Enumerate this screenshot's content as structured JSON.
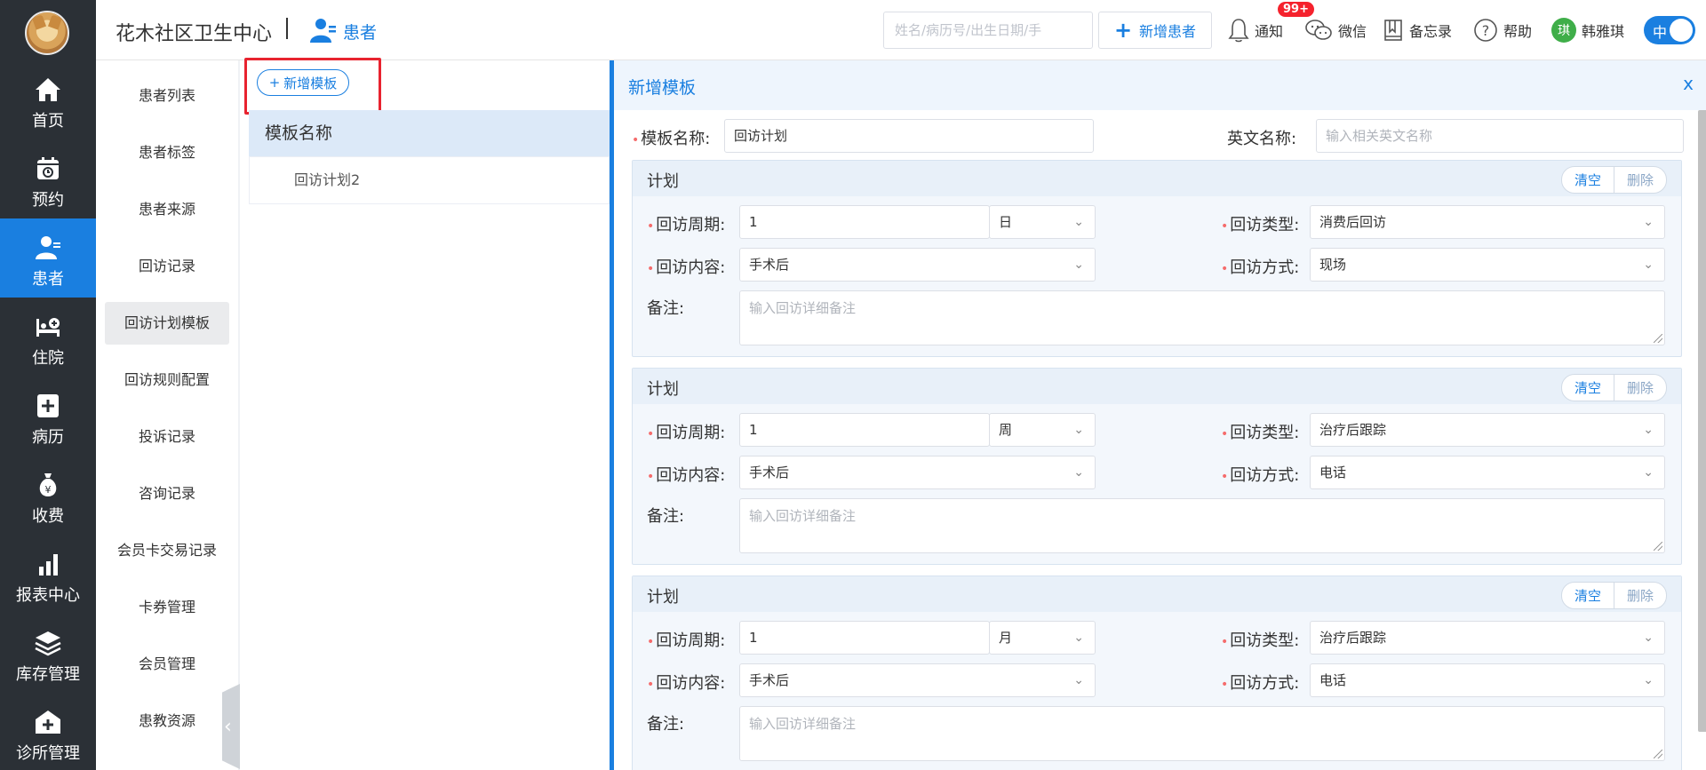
{
  "app": {
    "org_name": "花木社区卫生中心",
    "module": "患者"
  },
  "leftnav": [
    {
      "label": "首页",
      "icon": "home-icon"
    },
    {
      "label": "预约",
      "icon": "calendar-icon"
    },
    {
      "label": "患者",
      "icon": "patient-icon"
    },
    {
      "label": "住院",
      "icon": "bed-icon"
    },
    {
      "label": "病历",
      "icon": "medical-record-icon"
    },
    {
      "label": "收费",
      "icon": "money-bag-icon"
    },
    {
      "label": "报表中心",
      "icon": "bar-chart-icon"
    },
    {
      "label": "库存管理",
      "icon": "layers-icon"
    },
    {
      "label": "诊所管理",
      "icon": "clinic-icon"
    }
  ],
  "header": {
    "search_placeholder": "姓名/病历号/出生日期/手",
    "new_patient": "新增患者",
    "notify": "通知",
    "notify_badge": "99+",
    "wechat": "微信",
    "memo": "备忘录",
    "help": "帮助",
    "user_initial": "琪",
    "user_name": "韩雅琪",
    "lang": "中"
  },
  "submenu": [
    "患者列表",
    "患者标签",
    "患者来源",
    "回访记录",
    "回访计划模板",
    "回访规则配置",
    "投诉记录",
    "咨询记录",
    "会员卡交易记录",
    "卡券管理",
    "会员管理",
    "患教资源"
  ],
  "template_list": {
    "add_button": "新增模板",
    "column_header": "模板名称",
    "rows": [
      "回访计划2"
    ]
  },
  "form": {
    "title": "新增模板",
    "close": "x",
    "name_label": "模板名称:",
    "name_value": "回访计划",
    "en_label": "英文名称:",
    "en_placeholder": "输入相关英文名称",
    "labels": {
      "plan": "计划",
      "clear": "清空",
      "delete": "删除",
      "cycle": "回访周期:",
      "type": "回访类型:",
      "content": "回访内容:",
      "method": "回访方式:",
      "remark": "备注:",
      "remark_placeholder": "输入回访详细备注"
    },
    "plans": [
      {
        "cycle": "1",
        "unit": "日",
        "type": "消费后回访",
        "content": "手术后",
        "method": "现场"
      },
      {
        "cycle": "1",
        "unit": "周",
        "type": "治疗后跟踪",
        "content": "手术后",
        "method": "电话"
      },
      {
        "cycle": "1",
        "unit": "月",
        "type": "治疗后跟踪",
        "content": "手术后",
        "method": "电话"
      }
    ]
  },
  "colors": {
    "accent": "#1a7fe0",
    "nav_bg": "#2b3036",
    "highlight": "#e8232f",
    "required": "#f56c6c"
  }
}
